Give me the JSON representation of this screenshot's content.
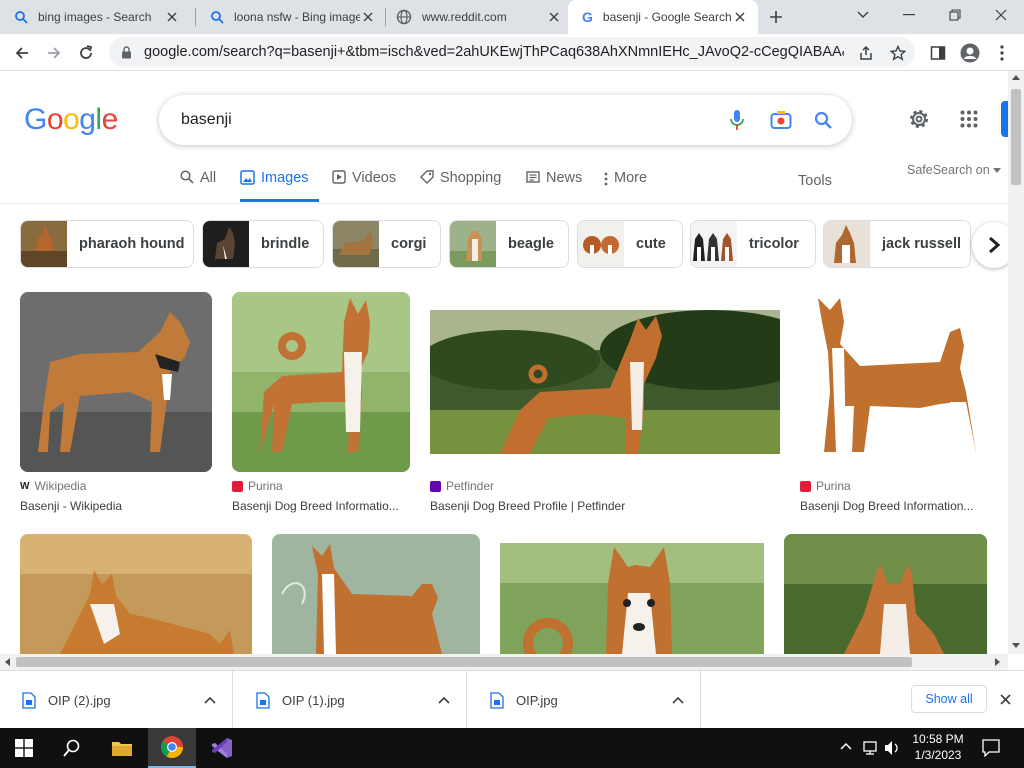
{
  "browser": {
    "tabs": [
      {
        "title": "bing images - Search",
        "favicon": "search-icon",
        "active": false
      },
      {
        "title": "loona nsfw - Bing images",
        "favicon": "search-icon",
        "active": false
      },
      {
        "title": "www.reddit.com",
        "favicon": "globe-icon",
        "active": false
      },
      {
        "title": "basenji - Google Search",
        "favicon": "google-g-icon",
        "active": true
      }
    ],
    "url": "google.com/search?q=basenji+&tbm=isch&ved=2ahUKEwjThPCaq638AhXNmnIEHc_JAvoQ2-cCegQIABAA&oq..."
  },
  "google": {
    "logo": [
      "G",
      "o",
      "o",
      "g",
      "l",
      "e"
    ],
    "logo_colors": [
      "#4285f4",
      "#ea4335",
      "#fbbc05",
      "#4285f4",
      "#34a853",
      "#ea4335"
    ],
    "query": "basenji",
    "nav_tabs": [
      {
        "label": "All",
        "icon": "search-icon"
      },
      {
        "label": "Images",
        "icon": "image-icon"
      },
      {
        "label": "Videos",
        "icon": "play-icon"
      },
      {
        "label": "Shopping",
        "icon": "tag-icon"
      },
      {
        "label": "News",
        "icon": "newspaper-icon"
      },
      {
        "label": "More",
        "icon": "more-vert-icon"
      }
    ],
    "tools_label": "Tools",
    "safesearch_label": "SafeSearch on",
    "chips": [
      {
        "label": "pharaoh hound"
      },
      {
        "label": "brindle"
      },
      {
        "label": "corgi"
      },
      {
        "label": "beagle"
      },
      {
        "label": "cute"
      },
      {
        "label": "tricolor"
      },
      {
        "label": "jack russell"
      }
    ],
    "results_row1": [
      {
        "source": "Wikipedia",
        "title": "Basenji - Wikipedia"
      },
      {
        "source": "Purina",
        "title": "Basenji Dog Breed Informatio..."
      },
      {
        "source": "Petfinder",
        "title": "Basenji Dog Breed Profile | Petfinder"
      },
      {
        "source": "Purina",
        "title": "Basenji Dog Breed Information..."
      }
    ]
  },
  "downloads": {
    "items": [
      {
        "name": "OIP (2).jpg"
      },
      {
        "name": "OIP (1).jpg"
      },
      {
        "name": "OIP.jpg"
      }
    ],
    "show_all_label": "Show all"
  },
  "taskbar": {
    "time": "10:58 PM",
    "date": "1/3/2023"
  },
  "colors": {
    "accent": "#1a73e8",
    "taskbar_bg": "#101010",
    "tabstrip_bg": "#dee1e6"
  }
}
